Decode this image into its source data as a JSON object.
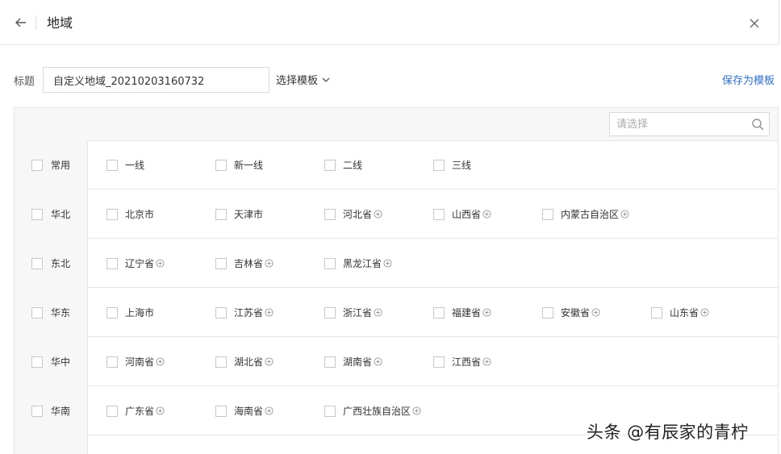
{
  "header": {
    "title": "地域"
  },
  "form": {
    "title_label": "标题",
    "title_value": "自定义地域_20210203160732",
    "template_select": "选择模板",
    "save_template": "保存为模板"
  },
  "search": {
    "placeholder": "请选择"
  },
  "rows": [
    {
      "region": "常用",
      "items": [
        {
          "label": "一线",
          "expand": false
        },
        {
          "label": "新一线",
          "expand": false
        },
        {
          "label": "二线",
          "expand": false
        },
        {
          "label": "三线",
          "expand": false
        }
      ]
    },
    {
      "region": "华北",
      "items": [
        {
          "label": "北京市",
          "expand": false
        },
        {
          "label": "天津市",
          "expand": false
        },
        {
          "label": "河北省",
          "expand": true
        },
        {
          "label": "山西省",
          "expand": true
        },
        {
          "label": "内蒙古自治区",
          "expand": true
        }
      ]
    },
    {
      "region": "东北",
      "items": [
        {
          "label": "辽宁省",
          "expand": true
        },
        {
          "label": "吉林省",
          "expand": true
        },
        {
          "label": "黑龙江省",
          "expand": true
        }
      ]
    },
    {
      "region": "华东",
      "items": [
        {
          "label": "上海市",
          "expand": false
        },
        {
          "label": "江苏省",
          "expand": true
        },
        {
          "label": "浙江省",
          "expand": true
        },
        {
          "label": "福建省",
          "expand": true
        },
        {
          "label": "安徽省",
          "expand": true
        },
        {
          "label": "山东省",
          "expand": true
        }
      ]
    },
    {
      "region": "华中",
      "items": [
        {
          "label": "河南省",
          "expand": true
        },
        {
          "label": "湖北省",
          "expand": true
        },
        {
          "label": "湖南省",
          "expand": true
        },
        {
          "label": "江西省",
          "expand": true
        }
      ]
    },
    {
      "region": "华南",
      "items": [
        {
          "label": "广东省",
          "expand": true
        },
        {
          "label": "海南省",
          "expand": true
        },
        {
          "label": "广西壮族自治区",
          "expand": true
        }
      ]
    }
  ],
  "watermark": "头条 @有辰家的青柠",
  "colors": {
    "link": "#2f6fd1",
    "panel_bg": "#f7f7f7",
    "border": "#e6e6e6"
  }
}
